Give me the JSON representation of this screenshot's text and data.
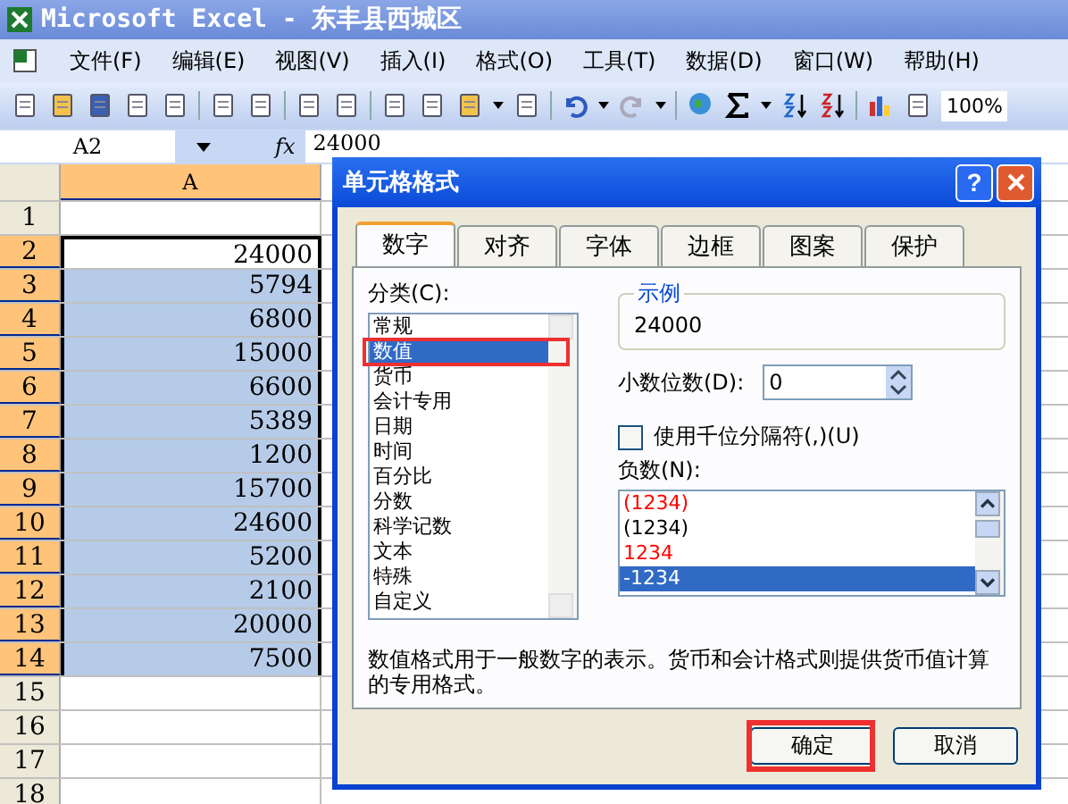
{
  "window": {
    "title": "Microsoft Excel - 东丰县西城区"
  },
  "menu": [
    "文件(F)",
    "编辑(E)",
    "视图(V)",
    "插入(I)",
    "格式(O)",
    "工具(T)",
    "数据(D)",
    "窗口(W)",
    "帮助(H)"
  ],
  "toolbar": {
    "zoom": "100%"
  },
  "formula_bar": {
    "name_box": "A2",
    "fx": "fx",
    "value": "24000"
  },
  "sheet": {
    "column": "A",
    "rows": [
      {
        "header": "1",
        "selected": false,
        "active": false
      },
      {
        "header": "2",
        "value": "24000",
        "selected": true,
        "active": true
      },
      {
        "header": "3",
        "value": "5794",
        "selected": true,
        "active": false
      },
      {
        "header": "4",
        "value": "6800",
        "selected": true,
        "active": false
      },
      {
        "header": "5",
        "value": "15000",
        "selected": true,
        "active": false
      },
      {
        "header": "6",
        "value": "6600",
        "selected": true,
        "active": false
      },
      {
        "header": "7",
        "value": "5389",
        "selected": true,
        "active": false
      },
      {
        "header": "8",
        "value": "1200",
        "selected": true,
        "active": false
      },
      {
        "header": "9",
        "value": "15700",
        "selected": true,
        "active": false
      },
      {
        "header": "10",
        "value": "24600",
        "selected": true,
        "active": false
      },
      {
        "header": "11",
        "value": "5200",
        "selected": true,
        "active": false
      },
      {
        "header": "12",
        "value": "2100",
        "selected": true,
        "active": false
      },
      {
        "header": "13",
        "value": "20000",
        "selected": true,
        "active": false
      },
      {
        "header": "14",
        "value": "7500",
        "selected": true,
        "active": false
      },
      {
        "header": "15",
        "selected": false,
        "active": false
      },
      {
        "header": "16",
        "selected": false,
        "active": false
      },
      {
        "header": "17",
        "selected": false,
        "active": false
      },
      {
        "header": "18",
        "selected": false,
        "active": false
      }
    ]
  },
  "dialog": {
    "title": "单元格格式",
    "help": "?",
    "tabs": [
      {
        "label": "数字",
        "selected": true
      },
      {
        "label": "对齐",
        "selected": false
      },
      {
        "label": "字体",
        "selected": false
      },
      {
        "label": "边框",
        "selected": false
      },
      {
        "label": "图案",
        "selected": false
      },
      {
        "label": "保护",
        "selected": false
      }
    ],
    "category_label": "分类(C):",
    "categories": [
      {
        "label": "常规",
        "selected": false,
        "highlighted": false
      },
      {
        "label": "数值",
        "selected": true,
        "highlighted": true
      },
      {
        "label": "货币",
        "selected": false,
        "highlighted": false
      },
      {
        "label": "会计专用",
        "selected": false,
        "highlighted": false
      },
      {
        "label": "日期",
        "selected": false,
        "highlighted": false
      },
      {
        "label": "时间",
        "selected": false,
        "highlighted": false
      },
      {
        "label": "百分比",
        "selected": false,
        "highlighted": false
      },
      {
        "label": "分数",
        "selected": false,
        "highlighted": false
      },
      {
        "label": "科学记数",
        "selected": false,
        "highlighted": false
      },
      {
        "label": "文本",
        "selected": false,
        "highlighted": false
      },
      {
        "label": "特殊",
        "selected": false,
        "highlighted": false
      },
      {
        "label": "自定义",
        "selected": false,
        "highlighted": false
      }
    ],
    "sample_label": "示例",
    "sample_value": "24000",
    "decimal_label": "小数位数(D):",
    "decimal_value": "0",
    "separator": {
      "label": "使用千位分隔符(,)(U)",
      "checked": false
    },
    "negative_label": "负数(N):",
    "negatives": [
      {
        "label": "(1234)",
        "color": "#ff0000",
        "selected": false
      },
      {
        "label": "(1234)",
        "color": "#000000",
        "selected": false
      },
      {
        "label": "1234",
        "color": "#ff0000",
        "selected": false
      },
      {
        "label": "-1234",
        "selected": true
      }
    ],
    "description": "数值格式用于一般数字的表示。货币和会计格式则提供货币值计算的专用格式。",
    "buttons": [
      {
        "label": "确定",
        "highlighted": true
      },
      {
        "label": "取消",
        "highlighted": false
      }
    ]
  }
}
